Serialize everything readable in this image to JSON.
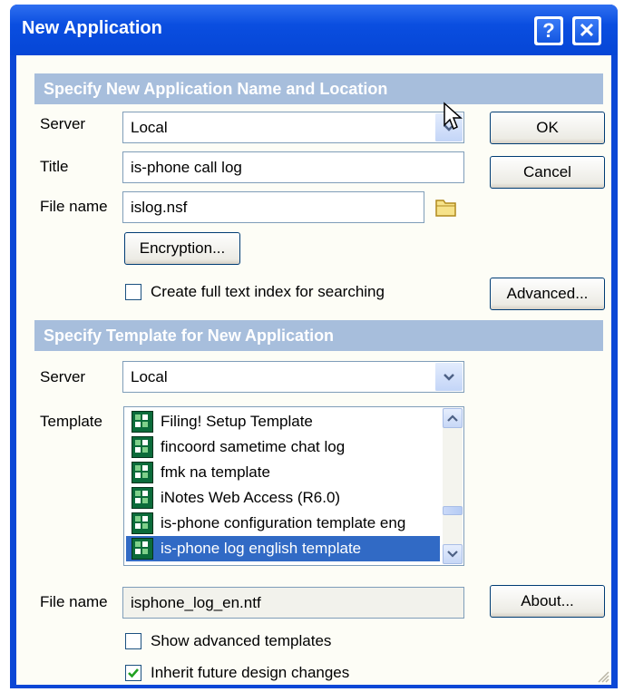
{
  "window": {
    "title": "New Application",
    "help_glyph": "?",
    "close_glyph": "✕"
  },
  "location_section": {
    "heading": "Specify New Application Name and Location",
    "server_label": "Server",
    "server_value": "Local",
    "title_label": "Title",
    "title_value": "is-phone call log",
    "filename_label": "File name",
    "filename_value": "islog.nsf",
    "encryption_button": "Encryption...",
    "fulltext_label": "Create full text index for searching",
    "fulltext_checked": false
  },
  "buttons": {
    "ok": "OK",
    "cancel": "Cancel",
    "advanced": "Advanced...",
    "about": "About..."
  },
  "template_section": {
    "heading": "Specify Template for New Application",
    "server_label": "Server",
    "server_value": "Local",
    "template_label": "Template",
    "templates": [
      {
        "label": "Filing! Setup Template",
        "selected": false
      },
      {
        "label": "fincoord sametime chat log",
        "selected": false
      },
      {
        "label": "fmk na template",
        "selected": false
      },
      {
        "label": "iNotes Web Access (R6.0)",
        "selected": false
      },
      {
        "label": "is-phone configuration template eng",
        "selected": false
      },
      {
        "label": "is-phone log english template",
        "selected": true
      }
    ],
    "filename_label": "File name",
    "filename_value": "isphone_log_en.ntf",
    "show_advanced_label": "Show advanced templates",
    "show_advanced_checked": false,
    "inherit_label": "Inherit future design changes",
    "inherit_checked": true
  },
  "icons": {
    "folder": "folder-icon",
    "dropdown": "chevron-down-icon",
    "template_db": "notes-database-icon",
    "cursor": "mouse-pointer-icon",
    "resize": "resize-grip-icon"
  },
  "colors": {
    "titlebar": "#0a4ee0",
    "section_bar": "#a7bedc",
    "selection": "#316ac5",
    "dialog_face": "#fdfdf6"
  }
}
